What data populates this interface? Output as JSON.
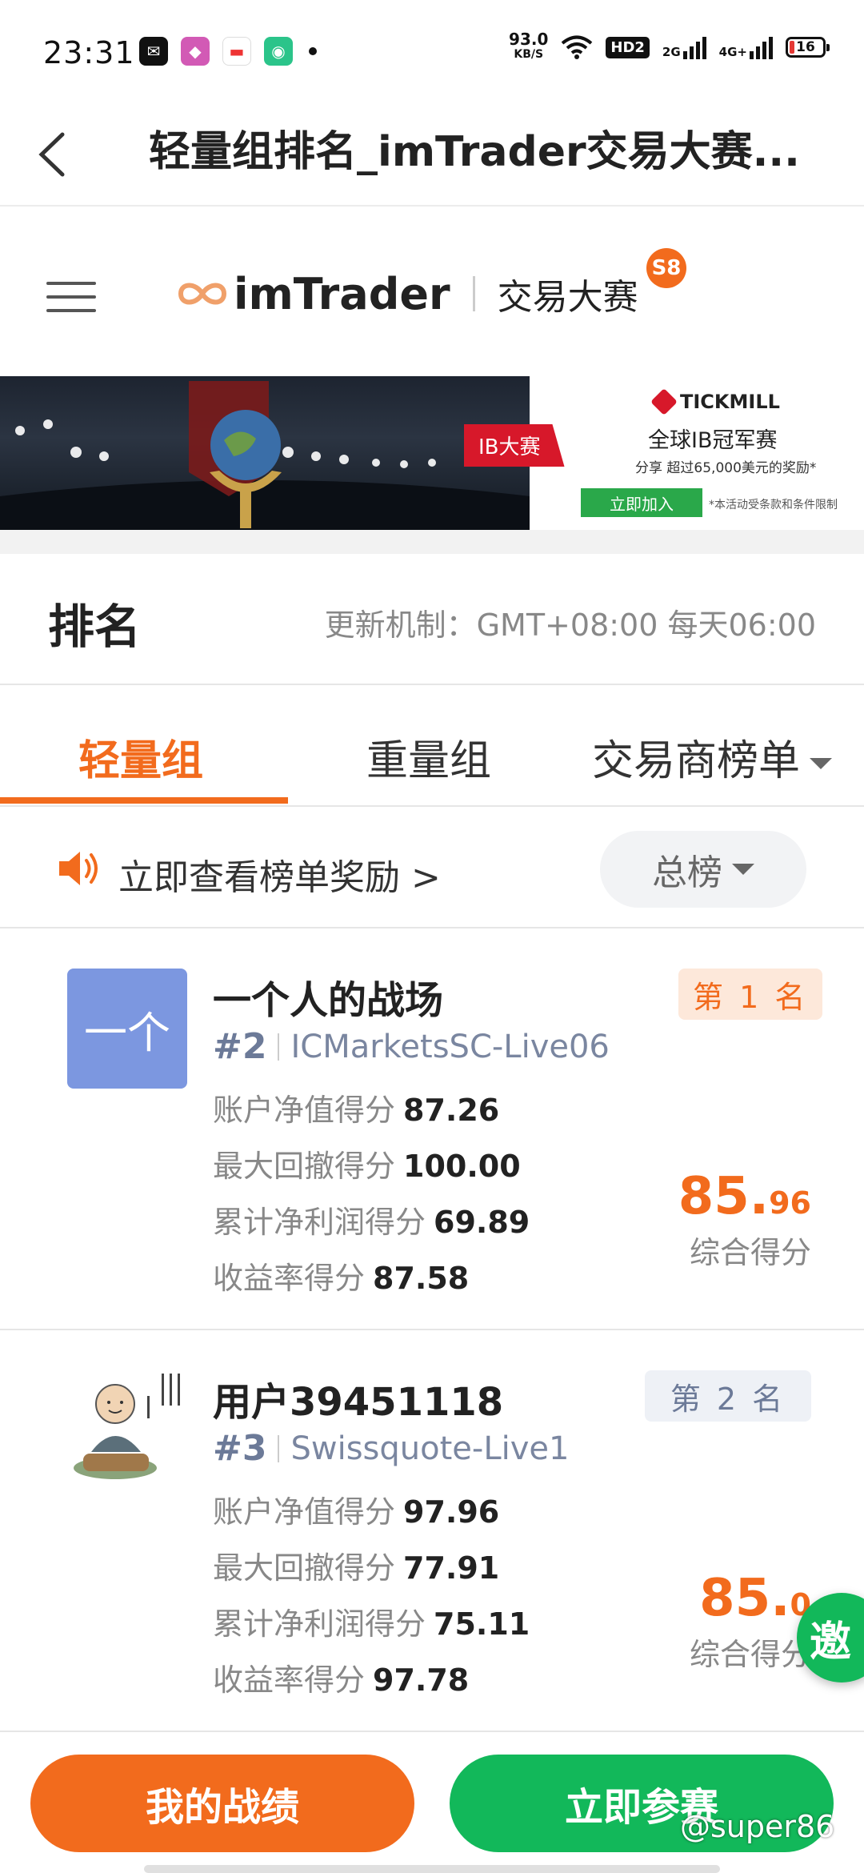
{
  "status_bar": {
    "time": "23:31",
    "net_speed_value": "93.0",
    "net_speed_unit": "KB/S",
    "hd_label": "HD2",
    "sig1_label": "2G",
    "sig2_label": "4G+",
    "battery": "16"
  },
  "header": {
    "title": "轻量组排名_imTrader交易大赛..."
  },
  "site": {
    "brand": "imTrader",
    "contest": "交易大赛",
    "season": "S8"
  },
  "banner": {
    "tag": "IB大赛",
    "sponsor": "TICKMILL",
    "headline": "全球IB冠军赛",
    "subline": "分享 超过65,000美元的奖励*",
    "cta": "立即加入",
    "fineprint": "*本活动受条款和条件限制"
  },
  "ranking": {
    "title": "排名",
    "update_rule": "更新机制：GMT+08:00 每天06:00"
  },
  "tabs": [
    {
      "label": "轻量组",
      "active": true
    },
    {
      "label": "重量组",
      "active": false
    },
    {
      "label": "交易商榜单",
      "active": false
    }
  ],
  "notice": {
    "text": "立即查看榜单奖励 >",
    "filter": "总榜"
  },
  "entries": [
    {
      "avatar_text": "一个",
      "name": "一个人的战场",
      "seat": "#2",
      "server": "ICMarketsSC-Live06",
      "rank": "第 1 名",
      "metrics": [
        {
          "label": "账户净值得分",
          "value": "87.26"
        },
        {
          "label": "最大回撤得分",
          "value": "100.00"
        },
        {
          "label": "累计净利润得分",
          "value": "69.89"
        },
        {
          "label": "收益率得分",
          "value": "87.58"
        }
      ],
      "score_int": "85.",
      "score_dec": "96",
      "score_label": "综合得分"
    },
    {
      "avatar_text": "",
      "name": "用户39451118",
      "seat": "#3",
      "server": "Swissquote-Live1",
      "rank": "第 2 名",
      "metrics": [
        {
          "label": "账户净值得分",
          "value": "97.96"
        },
        {
          "label": "最大回撤得分",
          "value": "77.91"
        },
        {
          "label": "累计净利润得分",
          "value": "75.11"
        },
        {
          "label": "收益率得分",
          "value": "97.78"
        }
      ],
      "score_int": "85.",
      "score_dec": "0",
      "score_label": "综合得分"
    }
  ],
  "floating": {
    "invite": "邀"
  },
  "bottom": {
    "my_record": "我的战绩",
    "join_now": "立即参赛",
    "watermark": "@super86"
  },
  "colors": {
    "accent": "#f26b1d",
    "green": "#12b85a",
    "avatar_blue": "#7c97e0"
  }
}
